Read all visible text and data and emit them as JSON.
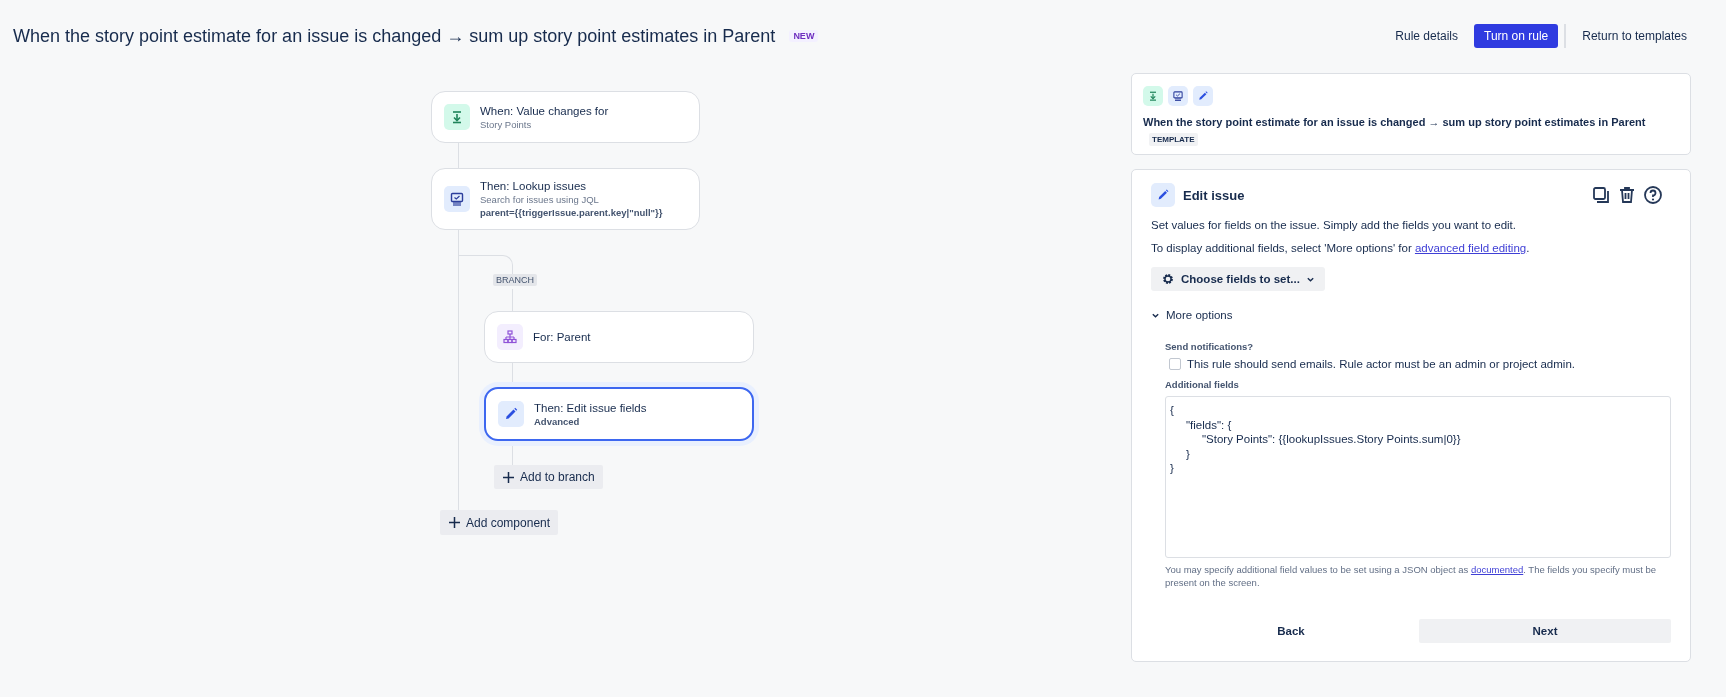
{
  "header": {
    "title": "When the story point estimate for an issue is changed → sum up story point estimates in Parent",
    "badge": "NEW",
    "actions": [
      {
        "label": "Rule details",
        "kind": "link"
      },
      {
        "label": "Turn on rule",
        "kind": "primary"
      },
      {
        "label": "Return to templates",
        "kind": "link"
      }
    ]
  },
  "flow": {
    "steps": [
      {
        "kind": "trigger",
        "title": "When: Value changes for",
        "subtitle": "Story Points",
        "selected": false
      },
      {
        "kind": "lookup",
        "title": "Then: Lookup issues",
        "subtitle": "Search for issues using JQL",
        "code": "parent={{triggerIssue.parent.key|\"null\"}}",
        "selected": false
      }
    ],
    "branch": {
      "label": "BRANCH",
      "children": [
        {
          "kind": "branch",
          "title": "For: Parent",
          "selected": false
        },
        {
          "kind": "edit",
          "title": "Then: Edit issue fields",
          "subtitle": "Advanced",
          "selected": true
        }
      ],
      "add_button": "Add to branch"
    },
    "add_button": "Add component"
  },
  "summary": {
    "icons": [
      {
        "kind": "trigger"
      },
      {
        "kind": "lookup"
      },
      {
        "kind": "edit"
      }
    ],
    "title": "When the story point estimate for an issue is changed → sum up story point estimates in Parent",
    "tag": "TEMPLATE"
  },
  "editor": {
    "kind": "edit",
    "title": "Edit issue",
    "description": "Set values for fields on the issue. Simply add the fields you want to edit.",
    "hint": {
      "before": "To display additional fields, select 'More options' for ",
      "link": "advanced field editing",
      "after": "."
    },
    "choose_button": "Choose fields to set...",
    "more_options": {
      "label": "More options",
      "expanded": true
    },
    "notifications": {
      "label": "Send notifications?",
      "checkbox": {
        "label": "This rule should send emails. Rule actor must be an admin or project admin.",
        "checked": false
      }
    },
    "additional_fields": {
      "label": "Additional fields",
      "value": "{\n\t\"fields\": {\n\t\t\"Story Points\": {{lookupIssues.Story Points.sum|0}}\n\t}\n}"
    },
    "help": {
      "before": "You may specify additional field values to be set using a JSON object as ",
      "link": "documented",
      "after": ". The fields you specify must be present on the screen."
    },
    "buttons": [
      {
        "label": "Back",
        "kind": "subtle"
      },
      {
        "label": "Next",
        "kind": "default"
      }
    ]
  }
}
